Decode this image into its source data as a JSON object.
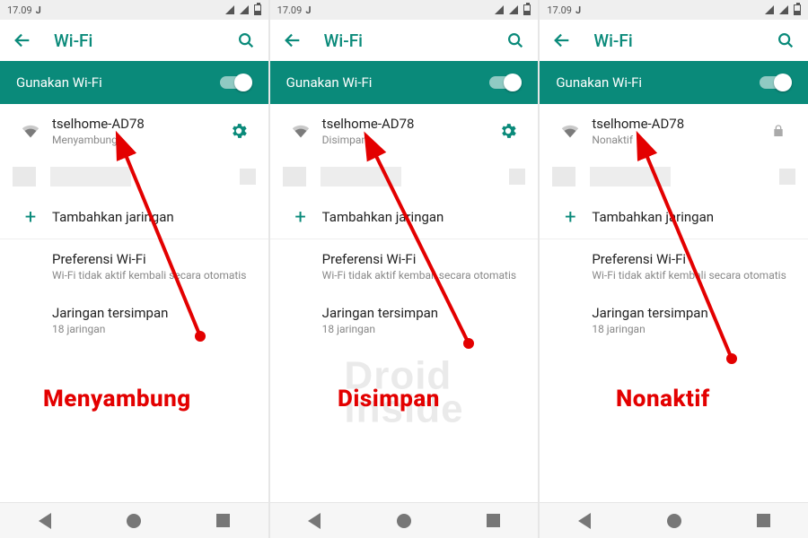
{
  "status": {
    "time": "17.09",
    "icon_letter": "J"
  },
  "header": {
    "title": "Wi-Fi"
  },
  "banner": {
    "label": "Gunakan Wi-Fi",
    "enabled": true
  },
  "network": {
    "ssid": "tselhome-AD78"
  },
  "add_network_label": "Tambahkan jaringan",
  "preferences": {
    "title": "Preferensi Wi-Fi",
    "subtitle": "Wi-Fi tidak aktif kembali secara otomatis"
  },
  "saved_networks": {
    "title": "Jaringan tersimpan",
    "subtitle": "18 jaringan"
  },
  "panels": [
    {
      "status_text": "Menyambung…",
      "trail": "gear",
      "annotation": "Menyambung"
    },
    {
      "status_text": "Disimpan",
      "trail": "gear",
      "annotation": "Disimpan"
    },
    {
      "status_text": "Nonaktif",
      "trail": "lock",
      "annotation": "Nonaktif"
    }
  ],
  "watermark": {
    "line1": "Droid",
    "line2": "inside"
  },
  "colors": {
    "teal": "#0a8a7a",
    "red": "#e30000"
  }
}
